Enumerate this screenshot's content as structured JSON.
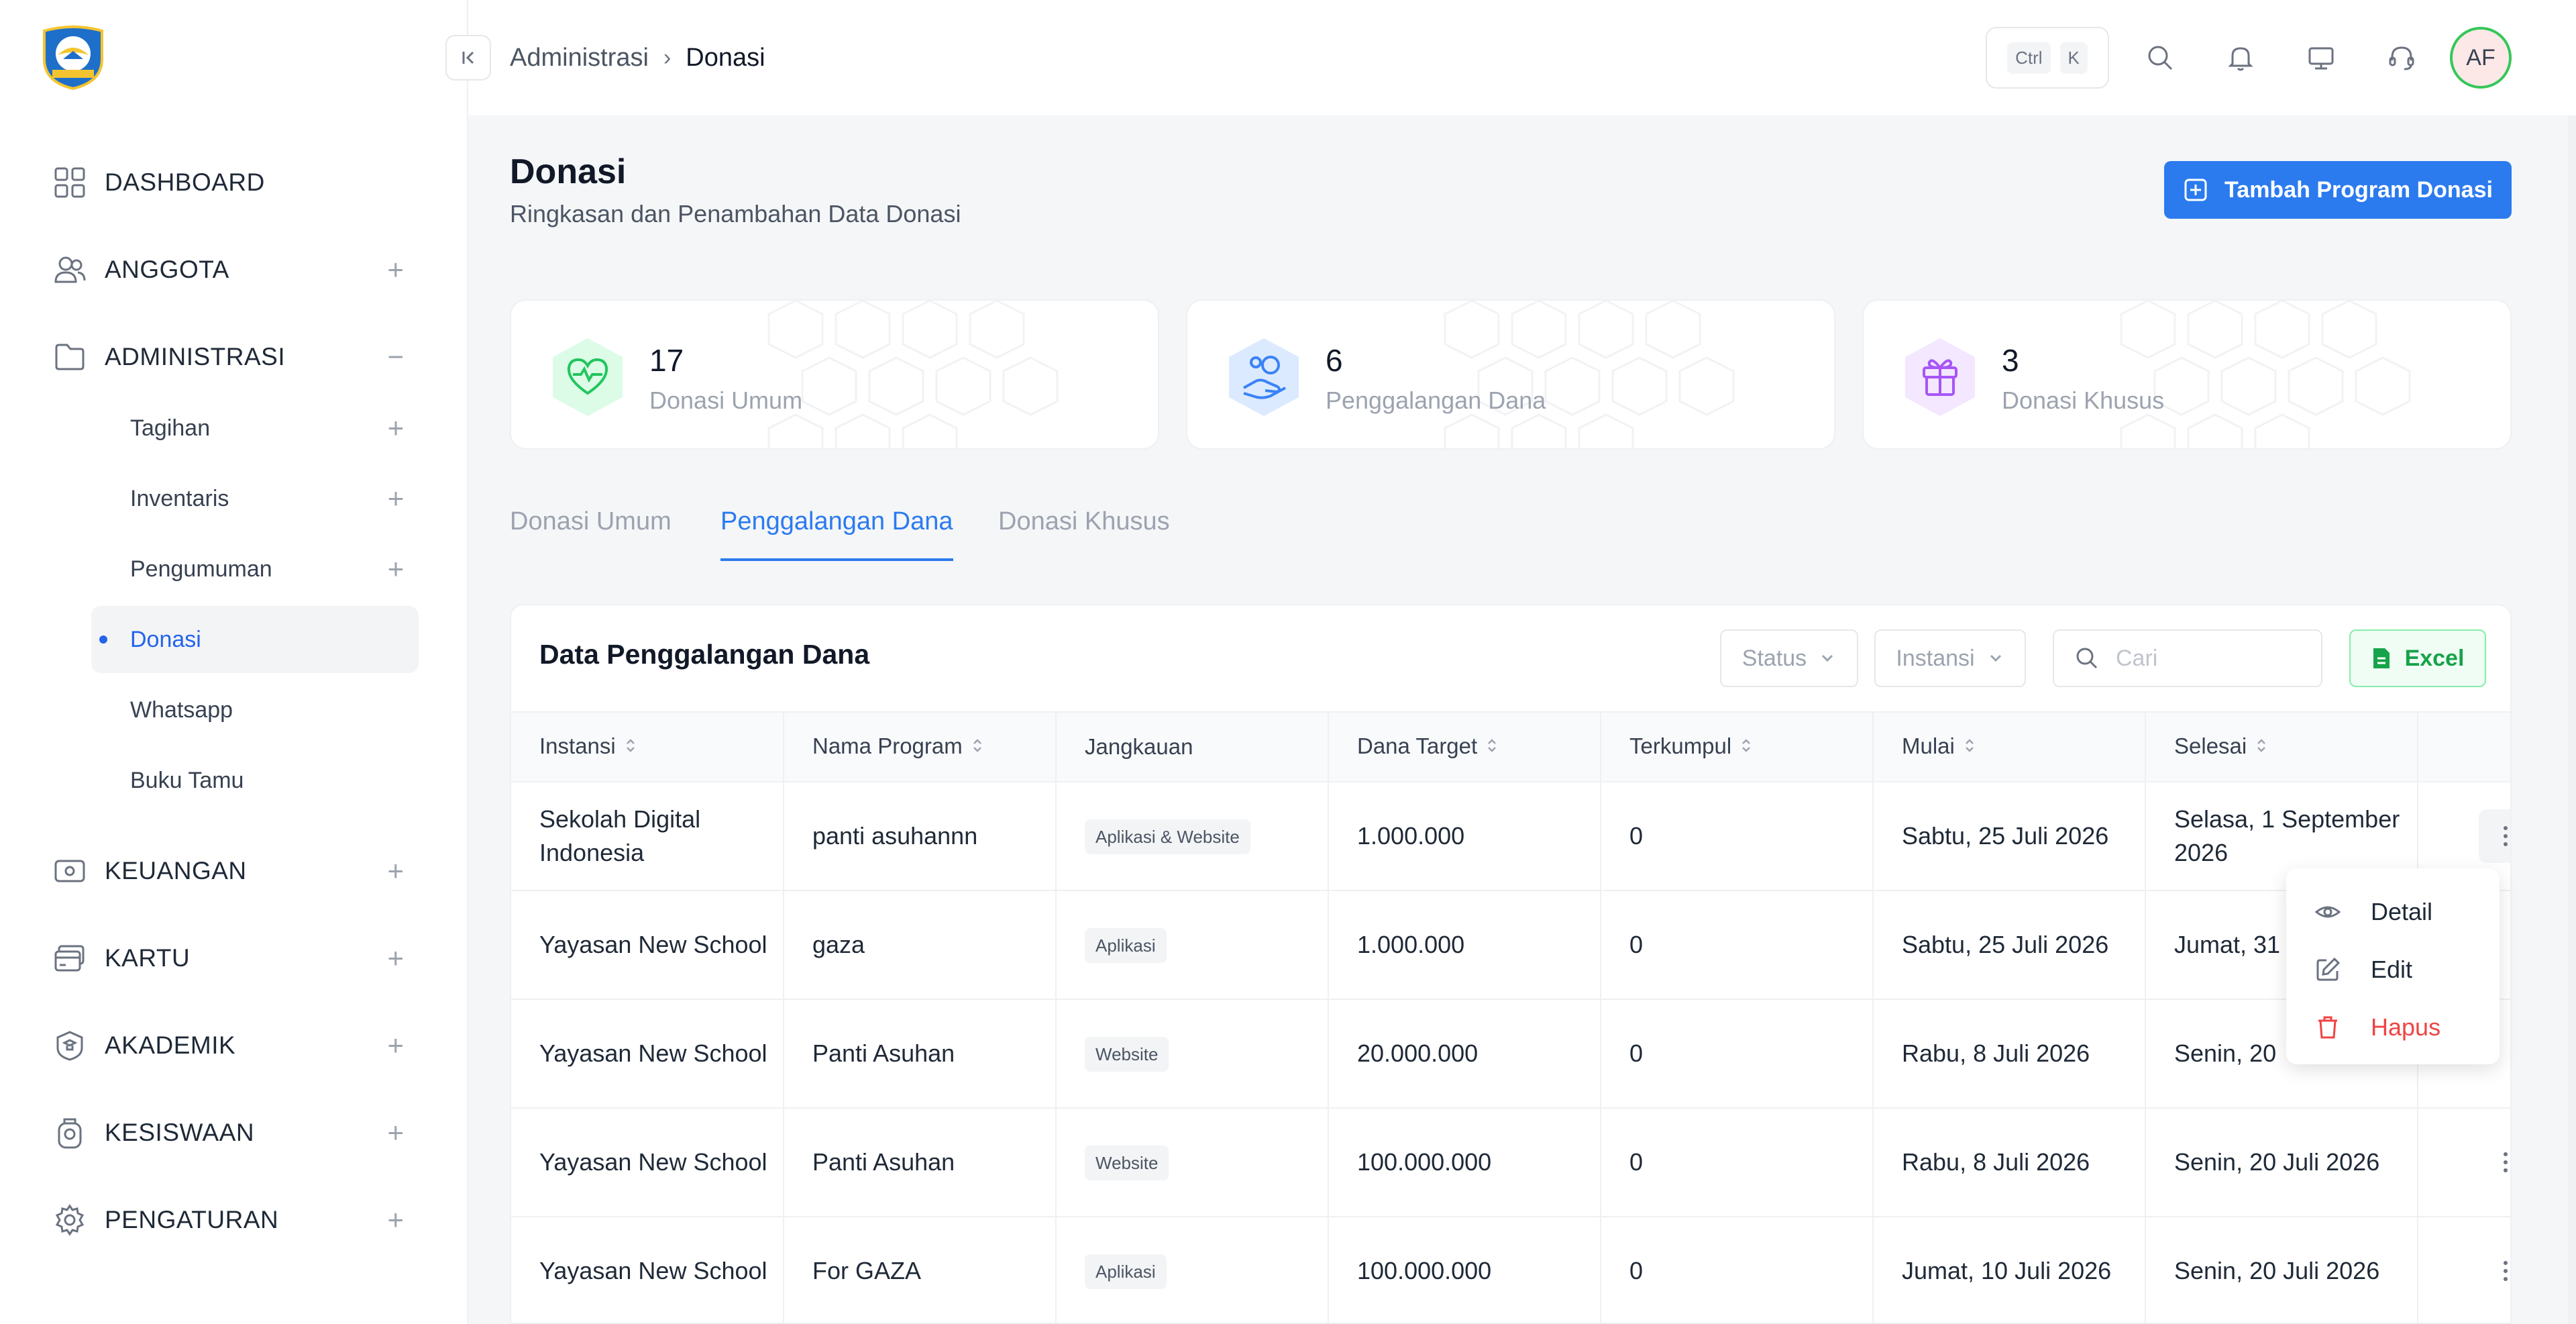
{
  "sidebar": {
    "nav": [
      {
        "label": "DASHBOARD",
        "icon": "dashboard-grid-icon",
        "toggle": ""
      },
      {
        "label": "ANGGOTA",
        "icon": "users-icon",
        "toggle": "+"
      },
      {
        "label": "ADMINISTRASI",
        "icon": "folder-icon",
        "toggle": "−"
      },
      {
        "label": "KEUANGAN",
        "icon": "wallet-icon",
        "toggle": "+"
      },
      {
        "label": "KARTU",
        "icon": "card-icon",
        "toggle": "+"
      },
      {
        "label": "AKADEMIK",
        "icon": "academic-icon",
        "toggle": "+"
      },
      {
        "label": "KESISWAAN",
        "icon": "student-icon",
        "toggle": "+"
      },
      {
        "label": "PENGATURAN",
        "icon": "gear-icon",
        "toggle": "+"
      }
    ],
    "sub": [
      {
        "label": "Tagihan",
        "toggle": "+"
      },
      {
        "label": "Inventaris",
        "toggle": "+"
      },
      {
        "label": "Pengumuman",
        "toggle": "+"
      },
      {
        "label": "Donasi",
        "toggle": ""
      },
      {
        "label": "Whatsapp",
        "toggle": ""
      },
      {
        "label": "Buku Tamu",
        "toggle": ""
      }
    ]
  },
  "header": {
    "breadcrumb": [
      "Administrasi",
      "Donasi"
    ],
    "shortcut": [
      "Ctrl",
      "K"
    ],
    "avatar": "AF"
  },
  "page": {
    "title": "Donasi",
    "subtitle": "Ringkasan dan Penambahan Data Donasi",
    "add_button": "Tambah Program Donasi"
  },
  "stats": [
    {
      "value": "17",
      "label": "Donasi Umum",
      "icon": "heart-pulse-icon",
      "color": "#22c55e"
    },
    {
      "value": "6",
      "label": "Penggalangan Dana",
      "icon": "hand-donate-icon",
      "color": "#3b82f6"
    },
    {
      "value": "3",
      "label": "Donasi Khusus",
      "icon": "gift-icon",
      "color": "#a855f7"
    }
  ],
  "tabs": [
    "Donasi Umum",
    "Penggalangan Dana",
    "Donasi Khusus"
  ],
  "table": {
    "title": "Data Penggalangan Dana",
    "filters": {
      "status": "Status",
      "instansi": "Instansi"
    },
    "search_placeholder": "Cari",
    "excel": "Excel",
    "columns": [
      "Instansi",
      "Nama Program",
      "Jangkauan",
      "Dana Target",
      "Terkumpul",
      "Mulai",
      "Selesai"
    ],
    "rows": [
      {
        "instansi": "Sekolah Digital Indonesia",
        "program": "panti asuhannn",
        "jangkauan": "Aplikasi & Website",
        "target": "1.000.000",
        "terkumpul": "0",
        "mulai": "Sabtu, 25 Juli 2026",
        "selesai": "Selasa, 1 September 2026"
      },
      {
        "instansi": "Yayasan New School",
        "program": "gaza",
        "jangkauan": "Aplikasi",
        "target": "1.000.000",
        "terkumpul": "0",
        "mulai": "Sabtu, 25 Juli 2026",
        "selesai": "Jumat, 31"
      },
      {
        "instansi": "Yayasan New School",
        "program": "Panti Asuhan",
        "jangkauan": "Website",
        "target": "20.000.000",
        "terkumpul": "0",
        "mulai": "Rabu, 8 Juli 2026",
        "selesai": "Senin, 20"
      },
      {
        "instansi": "Yayasan New School",
        "program": "Panti Asuhan",
        "jangkauan": "Website",
        "target": "100.000.000",
        "terkumpul": "0",
        "mulai": "Rabu, 8 Juli 2026",
        "selesai": "Senin, 20 Juli 2026"
      },
      {
        "instansi": "Yayasan New School",
        "program": "For GAZA",
        "jangkauan": "Aplikasi",
        "target": "100.000.000",
        "terkumpul": "0",
        "mulai": "Jumat, 10 Juli 2026",
        "selesai": "Senin, 20 Juli 2026"
      }
    ]
  },
  "row_menu": [
    "Detail",
    "Edit",
    "Hapus"
  ]
}
